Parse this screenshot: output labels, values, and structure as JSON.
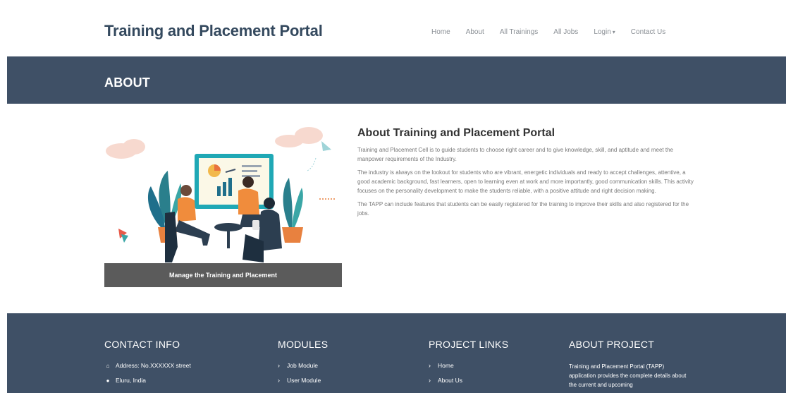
{
  "header": {
    "brand": "Training and Placement Portal",
    "nav": [
      {
        "label": "Home"
      },
      {
        "label": "About"
      },
      {
        "label": "All Trainings"
      },
      {
        "label": "All Jobs"
      },
      {
        "label": "Login"
      },
      {
        "label": "Contact Us"
      }
    ],
    "login_caret": "▾"
  },
  "banner": {
    "title": "ABOUT"
  },
  "about": {
    "image_caption": "Manage the Training and Placement",
    "title": "About Training and Placement Portal",
    "paragraphs": [
      "Training and Placement Cell is to guide students to choose right career and to give knowledge, skill, and aptitude and meet the manpower requirements of the Industry.",
      "The industry is always on the lookout for students who are vibrant, energetic individuals and ready to accept challenges, attentive, a good academic background, fast learners, open to learning even at work and more importantly, good communication skills. This activity focuses on the personality development to make the students reliable, with a positive attitude and right decision making.",
      "The TAPP can include features that students can be easily registered for the training to improve their skills and also registered for the jobs."
    ]
  },
  "footer": {
    "contact": {
      "heading": "CONTACT INFO",
      "items": [
        {
          "icon": "home-icon",
          "text": "Address: No.XXXXXX street"
        },
        {
          "icon": "globe-icon",
          "text": "Eluru, India"
        }
      ]
    },
    "modules": {
      "heading": "MODULES",
      "items": [
        "Job Module",
        "User Module"
      ]
    },
    "links": {
      "heading": "PROJECT LINKS",
      "items": [
        "Home",
        "About Us"
      ]
    },
    "about_project": {
      "heading": "ABOUT PROJECT",
      "text": "Training and Placement Portal (TAPP) application provides the complete details about the current and upcoming"
    }
  },
  "colors": {
    "brand": "#34495e",
    "banner_bg": "#3f5066",
    "footer_bg": "#3f5066",
    "caption_bg": "#5b5b5b"
  }
}
